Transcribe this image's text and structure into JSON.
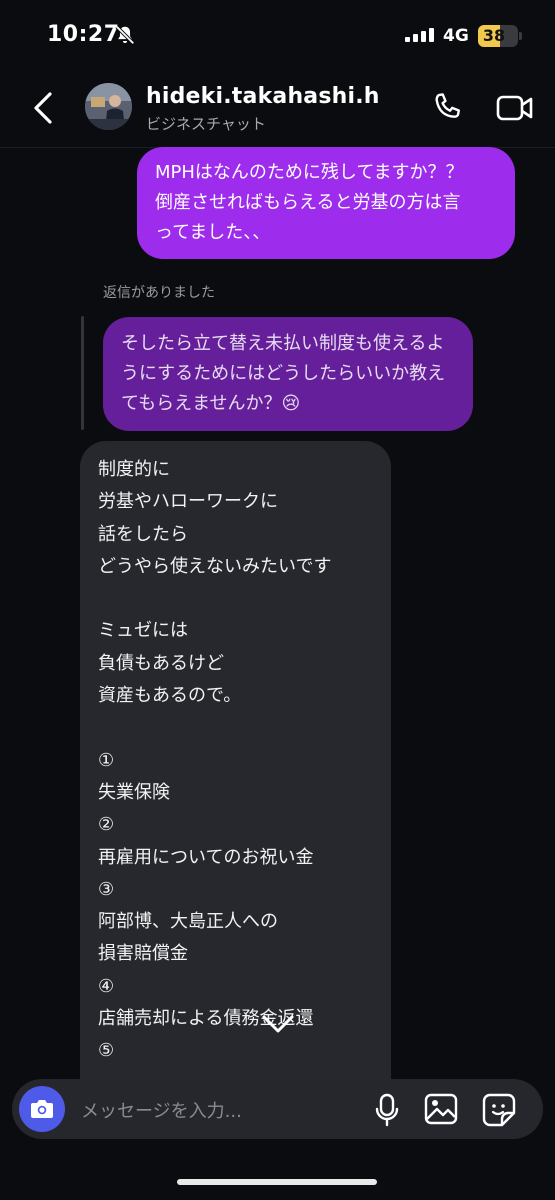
{
  "status_bar": {
    "time": "10:27",
    "network": "4G",
    "battery": "38"
  },
  "header": {
    "username": "hideki.takahashi.h",
    "subtitle": "ビジネスチャット"
  },
  "messages": {
    "outgoing_1": "MPHはなんのために残してますか？？\n倒産させればもらえると労基の方は言\nってました、、",
    "reply_note": "返信がありました",
    "quoted": "そしたら立て替え未払い制度も使えるよ\nうにするためにはどうしたらいいか教え\nてもらえませんか？😢",
    "incoming": "制度的に\n労基やハローワークに\n話をしたら\nどうやら使えないみたいです\n\nミュゼには\n負債もあるけど\n資産もあるので。\n\n①\n失業保険\n②\n再雇用についてのお祝い金\n③\n阿部博、大島正人への\n損害賠償金\n④\n店舗売却による債務金返還\n⑤"
  },
  "composer": {
    "placeholder": "メッセージを入力..."
  },
  "colors": {
    "background": "#0b0c0f",
    "outgoing_bubble": "#9d2cec",
    "quoted_bubble": "#661f9b",
    "incoming_bubble": "#26282d",
    "camera_button": "#4e5ae8"
  }
}
